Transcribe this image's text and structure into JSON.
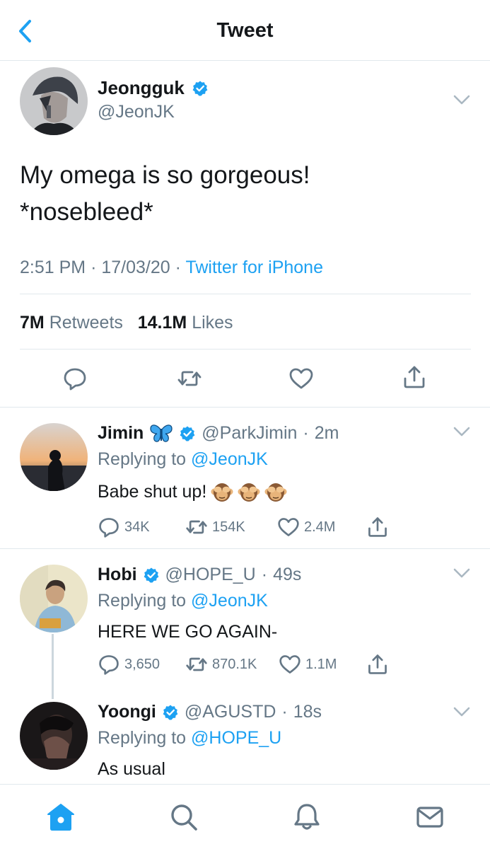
{
  "header": {
    "title": "Tweet",
    "back_icon": "chevron-left-icon"
  },
  "colors": {
    "accent": "#1da1f2",
    "muted": "#657786",
    "text": "#14171a",
    "divider": "#e1e8ed"
  },
  "main_tweet": {
    "name": "Jeongguk",
    "handle": "@JeonJK",
    "text_line1": "My omega is so gorgeous!",
    "text_line2": "*nosebleed*",
    "time": "2:51 PM",
    "date": "17/03/20",
    "source": "Twitter for iPhone",
    "retweets_count": "7M",
    "retweets_label": "Retweets",
    "likes_count": "14.1M",
    "likes_label": "Likes"
  },
  "replies": [
    {
      "name": "Jimin",
      "handle": "@ParkJimin",
      "time": "2m",
      "replying_label": "Replying to",
      "replying_to": "@JeonJK",
      "text": "Babe shut up!",
      "comments": "34K",
      "retweets": "154K",
      "likes": "2.4M"
    },
    {
      "name": "Hobi",
      "handle": "@HOPE_U",
      "time": "49s",
      "replying_label": "Replying to",
      "replying_to": "@JeonJK",
      "text": "HERE WE GO AGAIN-",
      "comments": "3,650",
      "retweets": "870.1K",
      "likes": "1.1M"
    },
    {
      "name": "Yoongi",
      "handle": "@AGUSTD",
      "time": "18s",
      "replying_label": "Replying to",
      "replying_to": "@HOPE_U",
      "text": "As usual"
    }
  ],
  "tabbar": [
    "home-icon",
    "search-icon",
    "notifications-icon",
    "messages-icon"
  ]
}
